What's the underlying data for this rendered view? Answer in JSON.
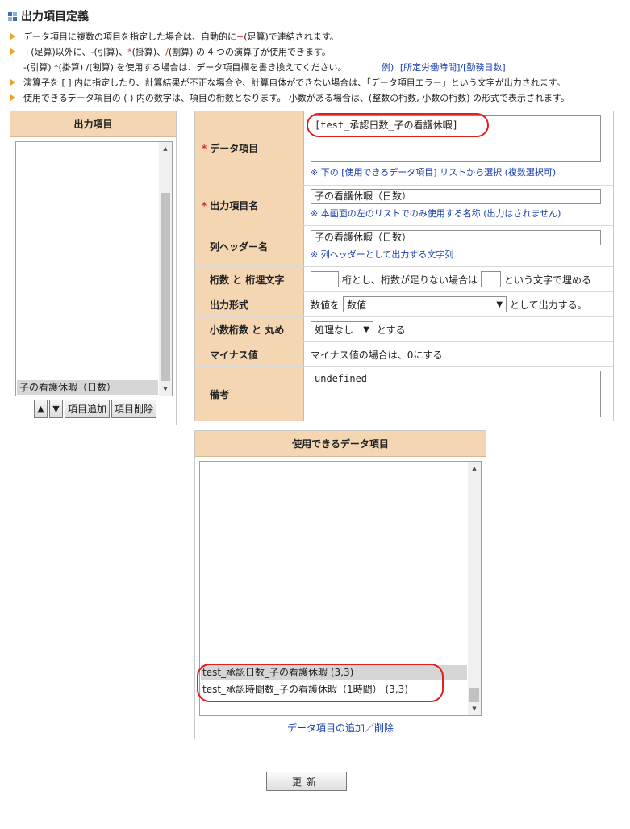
{
  "page": {
    "title": "出力項目定義"
  },
  "notes": [
    {
      "text_parts": [
        "データ項目に複数の項目を指定した場合は、自動的に",
        "+",
        "(足算)で連結されます。"
      ]
    },
    {
      "text_parts": [
        "+(足算)以外に、",
        "-",
        "(引算)、",
        "*",
        "(掛算)、",
        "/",
        "(割算) の 4 つの演算子が使用できます。"
      ]
    },
    {
      "line1": "-(引算) *(掛算) /(割算) を使用する場合は、データ項目欄を書き換えてください。",
      "example_label": "例)",
      "example_value": "[所定労働時間]/[勤務日数]"
    },
    {
      "text": "演算子を [ ] 内に指定したり、計算結果が不正な場合や、計算自体ができない場合は、「データ項目エラー」という文字が出力されます。"
    },
    {
      "text": "使用できるデータ項目の ( ) 内の数字は、項目の桁数となります。 小数がある場合は、(整数の桁数, 小数の桁数) の形式で表示されます。"
    }
  ],
  "output_items": {
    "header": "出力項目",
    "items": [
      "子の看護休暇（日数）"
    ],
    "buttons": {
      "up": "▲",
      "down": "▼",
      "add": "項目追加",
      "remove": "項目削除"
    }
  },
  "form": {
    "data_item": {
      "required_mark": "*",
      "label": "データ項目",
      "value": "[test_承認日数_子の看護休暇]",
      "hint": "※ 下の [使用できるデータ項目] リストから選択 (複数選択可)"
    },
    "output_name": {
      "required_mark": "*",
      "label": "出力項目名",
      "value": "子の看護休暇（日数）",
      "hint": "※ 本画面の左のリストでのみ使用する名称 (出力はされません)"
    },
    "column_header": {
      "label": "列ヘッダー名",
      "value": "子の看護休暇（日数）",
      "hint": "※ 列ヘッダーとして出力する文字列"
    },
    "digits": {
      "label": "桁数 と 桁埋文字",
      "text_mid": "桁とし、桁数が足りない場合は",
      "text_end": "という文字で埋める"
    },
    "output_format": {
      "label": "出力形式",
      "prefix": "数値を",
      "selected": "数値",
      "suffix": "として出力する。"
    },
    "decimal": {
      "label": "小数桁数 と 丸め",
      "selected": "処理なし",
      "suffix": "とする"
    },
    "minus": {
      "label": "マイナス値",
      "text": "マイナス値の場合は、0にする"
    },
    "remarks": {
      "label": "備考",
      "value": "undefined"
    }
  },
  "available_items": {
    "header": "使用できるデータ項目",
    "items": [
      {
        "label": "test_承認日数_子の看護休暇 (3,3)",
        "selected": true
      },
      {
        "label": "test_承認時間数_子の看護休暇（1時間） (3,3)",
        "selected": false
      }
    ],
    "link": "データ項目の追加／削除"
  },
  "update_button": "更新",
  "colors": {
    "header_bg": "#f5d6b3",
    "required": "#d03030",
    "hint": "#1a3fb0",
    "highlight": "#e02020",
    "bullet": "#f0a020"
  }
}
